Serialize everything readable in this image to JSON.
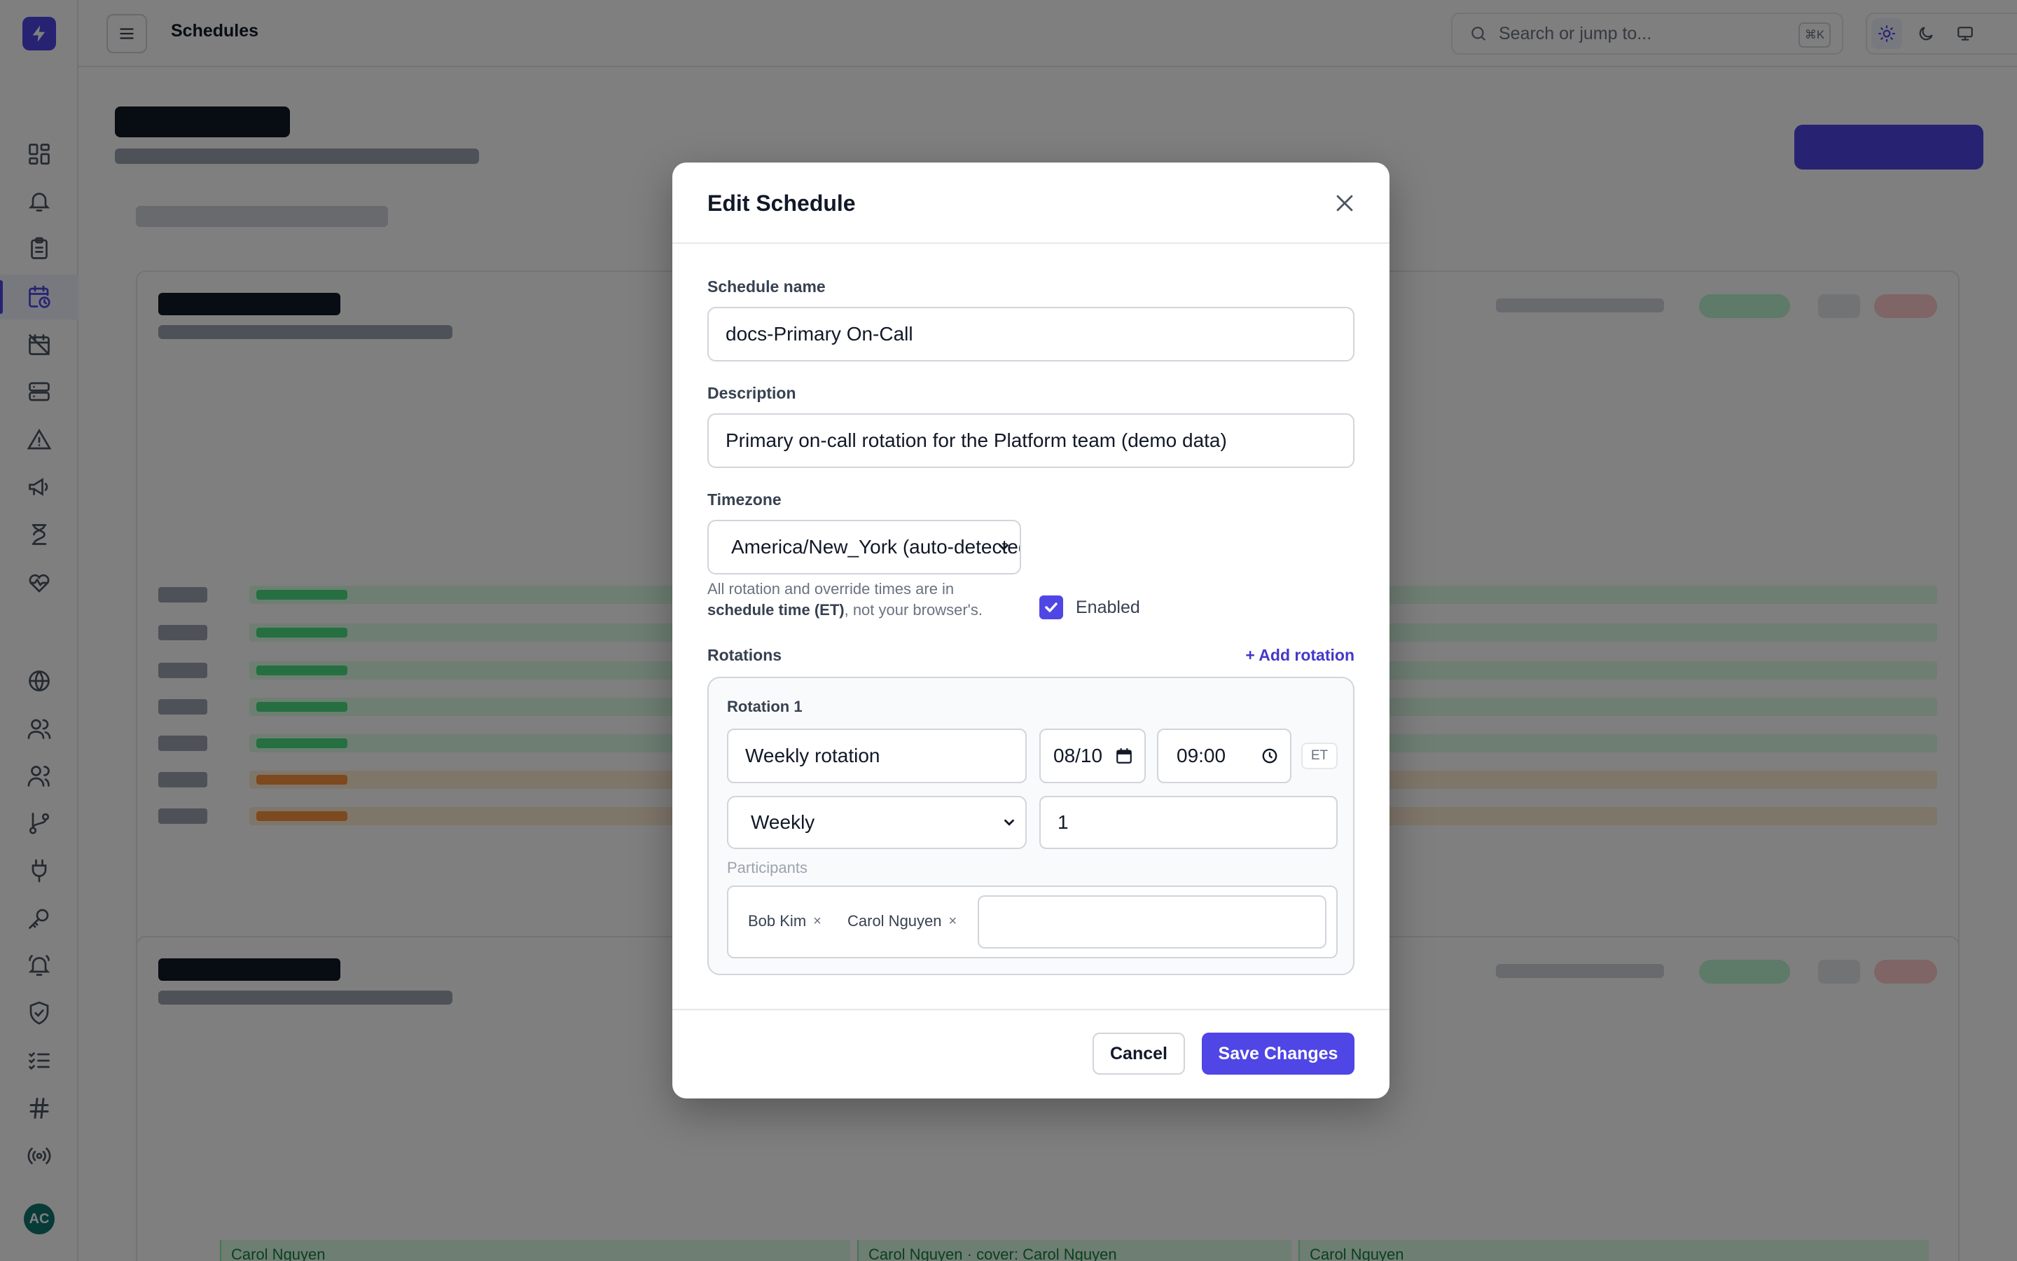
{
  "topbar": {
    "page_title": "Schedules",
    "search_placeholder": "Search or jump to...",
    "search_shortcut": "⌘K"
  },
  "sidebar": {
    "avatar_initials": "AC",
    "active_item": "schedules",
    "items": [
      {
        "id": "dashboard",
        "icon": "dashboard-icon"
      },
      {
        "id": "alerts",
        "icon": "bell-icon"
      },
      {
        "id": "tasks",
        "icon": "clipboard-icon"
      },
      {
        "id": "schedules",
        "icon": "calendar-clock-icon"
      },
      {
        "id": "maintenance",
        "icon": "calendar-off-icon"
      },
      {
        "id": "servers",
        "icon": "server-icon"
      },
      {
        "id": "incidents",
        "icon": "warning-icon"
      },
      {
        "id": "announcements",
        "icon": "megaphone-icon"
      },
      {
        "id": "timers",
        "icon": "hourglass-icon"
      },
      {
        "id": "health",
        "icon": "heartbeat-icon"
      },
      {
        "id": "status-pages",
        "icon": "globe-icon"
      },
      {
        "id": "users",
        "icon": "users-icon"
      },
      {
        "id": "teams",
        "icon": "team-icon"
      },
      {
        "id": "escalation",
        "icon": "branch-icon"
      },
      {
        "id": "integrations",
        "icon": "plug-icon"
      },
      {
        "id": "api-keys",
        "icon": "key-icon"
      },
      {
        "id": "notifications",
        "icon": "bell-ring-icon"
      },
      {
        "id": "security",
        "icon": "shield-check-icon"
      },
      {
        "id": "checklists",
        "icon": "checklist-icon"
      },
      {
        "id": "channels",
        "icon": "hash-icon"
      },
      {
        "id": "broadcast",
        "icon": "broadcast-icon"
      }
    ]
  },
  "background": {
    "gantt_bottom_cells": [
      "Carol Nguyen",
      "Carol Nguyen · cover: Carol Nguyen",
      "Carol Nguyen"
    ]
  },
  "modal": {
    "title": "Edit Schedule",
    "name_label": "Schedule name",
    "name_value": "docs-Primary On-Call",
    "description_label": "Description",
    "description_value": "Primary on-call rotation for the Platform team (demo data)",
    "timezone_label": "Timezone",
    "timezone_value": "America/New_York (auto-detected)",
    "hint_prefix": "All rotation and override times are in ",
    "hint_bold": "schedule time (ET)",
    "hint_suffix": ", not your browser's.",
    "enabled_label": "Enabled",
    "enabled": true,
    "rotations_label": "Rotations",
    "add_rotation_label": "+ Add rotation",
    "rotation": {
      "title": "Rotation 1",
      "name_value": "Weekly rotation",
      "start_date": "08/10",
      "start_time": "09:00",
      "tz_badge": "ET",
      "frequency_value": "Weekly",
      "interval_value": "1",
      "participants_label": "Participants",
      "participants": [
        "Bob Kim",
        "Carol Nguyen"
      ],
      "chip_remove": "×"
    },
    "cancel_label": "Cancel",
    "save_label": "Save Changes"
  },
  "colors": {
    "accent": "#4f46e5",
    "overlay": "rgba(0,0,0,0.5)"
  }
}
